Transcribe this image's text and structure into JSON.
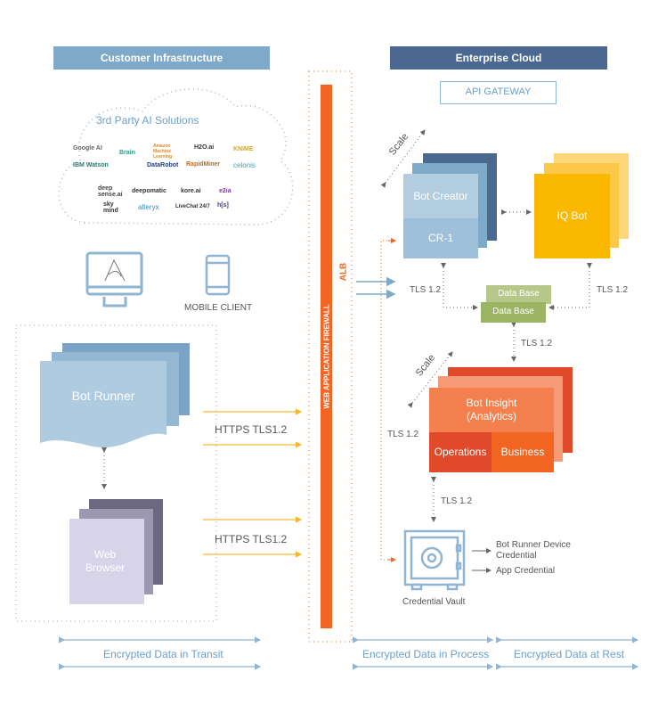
{
  "headers": {
    "customer": "Customer Infrastructure",
    "enterprise": "Enterprise Cloud"
  },
  "api_gateway": "API GATEWAY",
  "cloud": {
    "title": "3rd Party AI Solutions",
    "logos": [
      "Google AI",
      "Brain",
      "Amazon Machine Learning",
      "H2O.ai",
      "KNIME",
      "IBM Watson",
      "DataRobot",
      "RapidMiner",
      "celonis",
      "deep sense.ai",
      "deepomatic",
      "kore.ai",
      "e2ia",
      "sky mind",
      "alteryx",
      "LiveChat 24/7",
      "h[s]"
    ]
  },
  "clients": {
    "mobile": "MOBILE CLIENT"
  },
  "bot_runner": "Bot Runner",
  "web_browser": "Web Browser",
  "https_labels": [
    "HTTPS TLS1.2",
    "HTTPS TLS1.2"
  ],
  "waf": "WEB APPLICATION FIREWALL",
  "alb": "ALB",
  "scale": "Scale",
  "bot_creator": {
    "top": "Bot Creator",
    "bottom": "CR-1"
  },
  "iq_bot": "IQ Bot",
  "database": [
    "Data Base",
    "Data Base"
  ],
  "tls": "TLS 1.2",
  "bot_insight": {
    "title": "Bot Insight (Analytics)",
    "operations": "Operations",
    "business": "Business"
  },
  "vault": {
    "label": "Credential Vault",
    "outputs": [
      "Bot Runner Device Credential",
      "App Credential"
    ]
  },
  "footer": {
    "transit": "Encrypted Data in Transit",
    "process": "Encrypted Data in Process",
    "rest": "Encrypted Data at Rest"
  },
  "colors": {
    "customer_header": "#7ea9c9",
    "enterprise_header": "#4a6890",
    "waf": "#f26522",
    "https_arrow": "#f5b731",
    "bot_creator": "#9fc0da",
    "iq_bot": "#fbb800",
    "database": "#9bb562",
    "bot_insight": "#f4804f"
  }
}
